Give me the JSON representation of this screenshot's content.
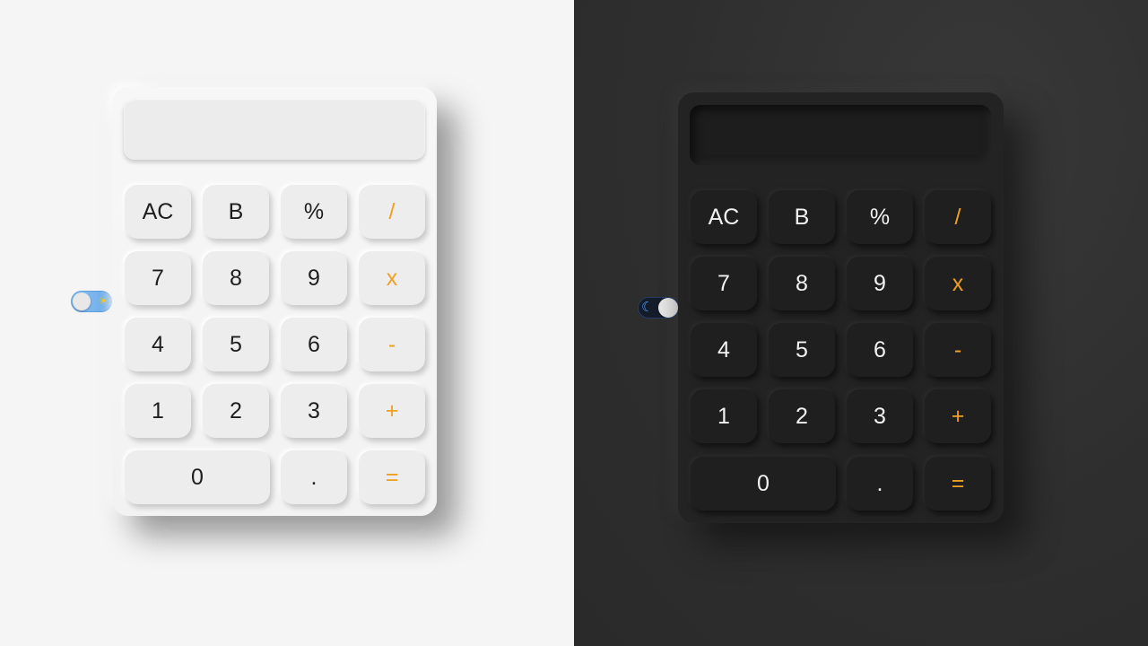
{
  "theme_light": {
    "toggle_symbol": "☀",
    "keys": {
      "ac": "AC",
      "back": "B",
      "percent": "%",
      "divide": "/",
      "seven": "7",
      "eight": "8",
      "nine": "9",
      "multiply": "x",
      "four": "4",
      "five": "5",
      "six": "6",
      "minus": "-",
      "one": "1",
      "two": "2",
      "three": "3",
      "plus": "+",
      "zero": "0",
      "dot": ".",
      "equals": "="
    }
  },
  "theme_dark": {
    "toggle_symbol": "☾",
    "keys": {
      "ac": "AC",
      "back": "B",
      "percent": "%",
      "divide": "/",
      "seven": "7",
      "eight": "8",
      "nine": "9",
      "multiply": "x",
      "four": "4",
      "five": "5",
      "six": "6",
      "minus": "-",
      "one": "1",
      "two": "2",
      "three": "3",
      "plus": "+",
      "zero": "0",
      "dot": ".",
      "equals": "="
    }
  },
  "colors": {
    "operator_accent": "#f0a020",
    "light_background": "#f5f5f5",
    "dark_background": "#2e2e2e"
  }
}
